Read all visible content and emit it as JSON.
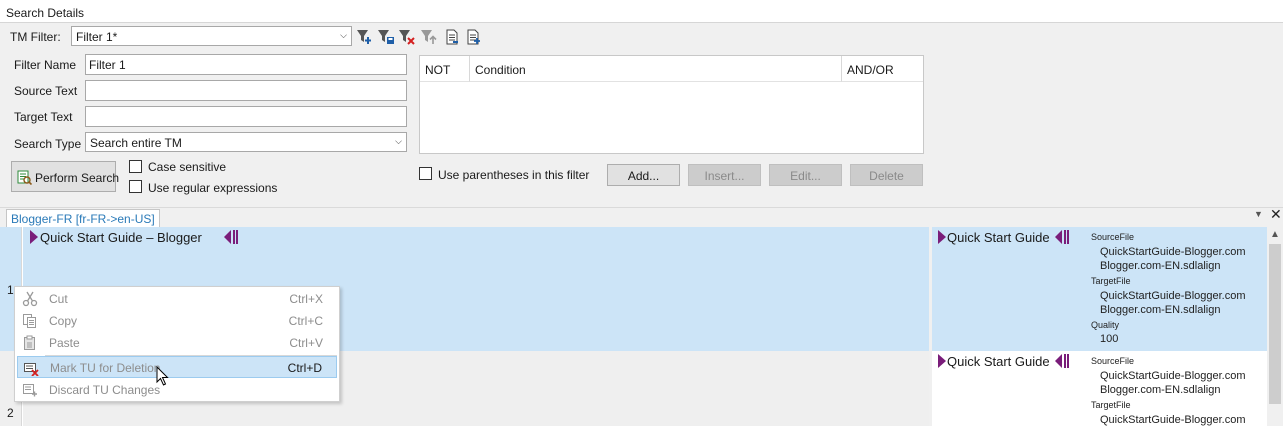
{
  "panel": {
    "title": "Search Details"
  },
  "filter_bar": {
    "label": "TM Filter:",
    "selected_filter": "Filter 1*",
    "toolbar_icons": [
      "add-filter-icon",
      "save-filter-icon",
      "delete-filter-icon",
      "export-filter-icon",
      "import-filter-icon",
      "filter-settings-icon"
    ]
  },
  "form": {
    "filter_name_label": "Filter Name",
    "filter_name_value": "Filter 1",
    "source_text_label": "Source Text",
    "source_text_value": "",
    "target_text_label": "Target Text",
    "target_text_value": "",
    "search_type_label": "Search Type",
    "search_type_value": "Search entire TM",
    "perform_search_label": "Perform Search",
    "case_sensitive_label": "Case sensitive",
    "case_sensitive_checked": false,
    "regex_label": "Use regular expressions",
    "regex_checked": false
  },
  "conditions": {
    "columns": [
      "NOT",
      "Condition",
      "AND/OR"
    ],
    "rows": [],
    "use_parentheses_label": "Use parentheses in this filter",
    "use_parentheses_checked": false,
    "buttons": {
      "add": "Add...",
      "insert": "Insert...",
      "edit": "Edit...",
      "delete": "Delete"
    }
  },
  "document_tab": {
    "label": "Blogger-FR [fr-FR->en-US]"
  },
  "segments": [
    {
      "number": "1",
      "source": "Quick Start Guide – Blogger",
      "target": "Quick Start Guide",
      "fields": [
        {
          "name": "SourceFile",
          "values": [
            "QuickStartGuide-Blogger.com",
            "Blogger.com-EN.sdlalign"
          ]
        },
        {
          "name": "TargetFile",
          "values": [
            "QuickStartGuide-Blogger.com",
            "Blogger.com-EN.sdlalign"
          ]
        },
        {
          "name": "Quality",
          "values": [
            "100"
          ]
        }
      ]
    },
    {
      "number": "2",
      "source": "",
      "target": "Quick Start Guide",
      "fields": [
        {
          "name": "SourceFile",
          "values": [
            "QuickStartGuide-Blogger.com",
            "Blogger.com-EN.sdlalign"
          ]
        },
        {
          "name": "TargetFile",
          "values": [
            "QuickStartGuide-Blogger.com"
          ]
        }
      ]
    }
  ],
  "context_menu": {
    "items": [
      {
        "label": "Cut",
        "shortcut": "Ctrl+X",
        "icon": "scissors-icon",
        "enabled": false
      },
      {
        "label": "Copy",
        "shortcut": "Ctrl+C",
        "icon": "copy-icon",
        "enabled": false
      },
      {
        "label": "Paste",
        "shortcut": "Ctrl+V",
        "icon": "paste-icon",
        "enabled": false
      },
      {
        "label": "Mark TU for Deletion",
        "shortcut": "Ctrl+D",
        "icon": "mark-delete-icon",
        "enabled": true,
        "highlighted": true
      },
      {
        "label": "Discard TU Changes",
        "shortcut": "",
        "icon": "discard-changes-icon",
        "enabled": false
      }
    ]
  },
  "colors": {
    "selected_row": "#cce4f7",
    "tag_marker": "#7a1d7a",
    "tab_text": "#2a7ab8",
    "menu_highlight": "#cce4f7"
  }
}
